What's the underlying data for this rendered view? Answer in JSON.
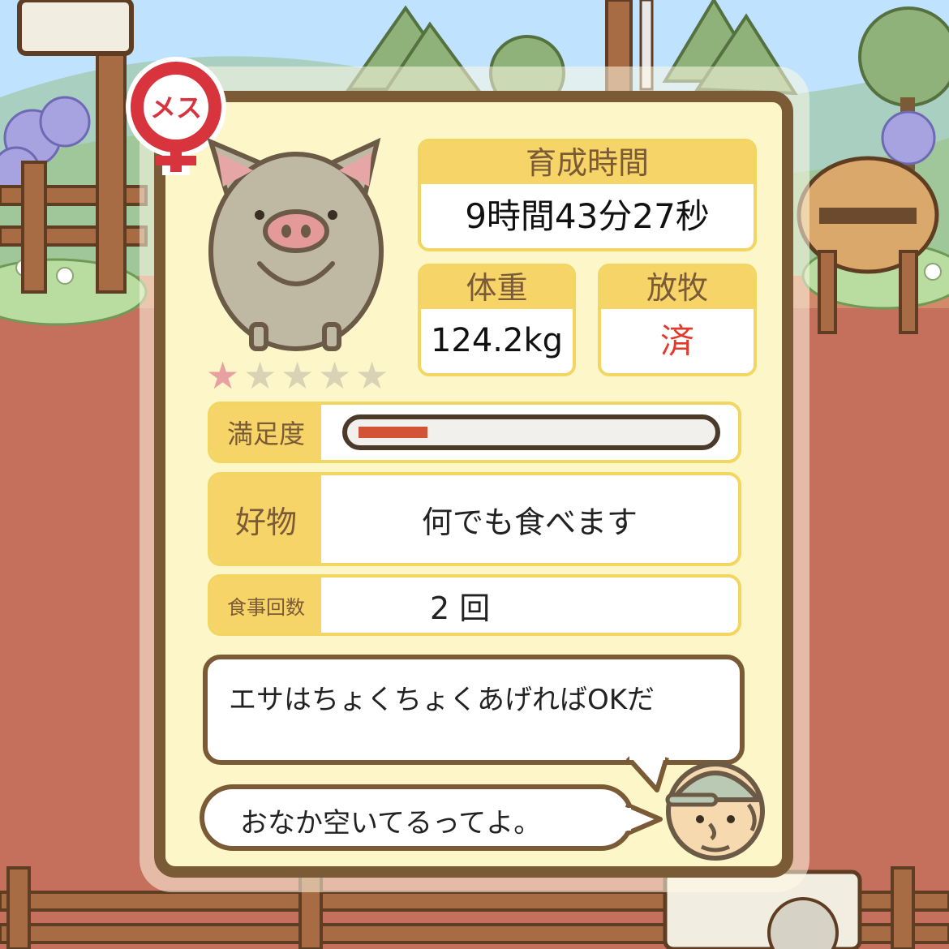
{
  "gender_badge": {
    "label": "メス"
  },
  "pig": {
    "stars": [
      {
        "glyph": "★",
        "color": "#e9a0a0"
      },
      {
        "glyph": "★",
        "color": "#d9d2b4"
      },
      {
        "glyph": "★",
        "color": "#d9d2b4"
      },
      {
        "glyph": "★",
        "color": "#d9d2b4"
      },
      {
        "glyph": "★",
        "color": "#d9d2b4"
      }
    ]
  },
  "stats": {
    "breeding_time": {
      "label": "育成時間",
      "value": "9時間43分27秒"
    },
    "weight": {
      "label": "体重",
      "value": "124.2kg"
    },
    "grazing": {
      "label": "放牧",
      "value": "済",
      "value_color": "#e23a2a"
    }
  },
  "satisfaction": {
    "label": "満足度",
    "level": 0.2,
    "bar_color": "#d35336"
  },
  "favorite": {
    "label": "好物",
    "value": "何でも食べます"
  },
  "meal_count": {
    "label": "食事回数",
    "value": "2 回"
  },
  "farmer": {
    "speech": "エサはちょくちょくあげればOKだ",
    "status": "おなか空いてるってよ。"
  },
  "colors": {
    "panel_border": "#7a5a37",
    "panel_fill": "#fcf6c9",
    "label_fill": "#f6d467",
    "ground": "#c5705c",
    "sky": "#bfe3ff"
  }
}
